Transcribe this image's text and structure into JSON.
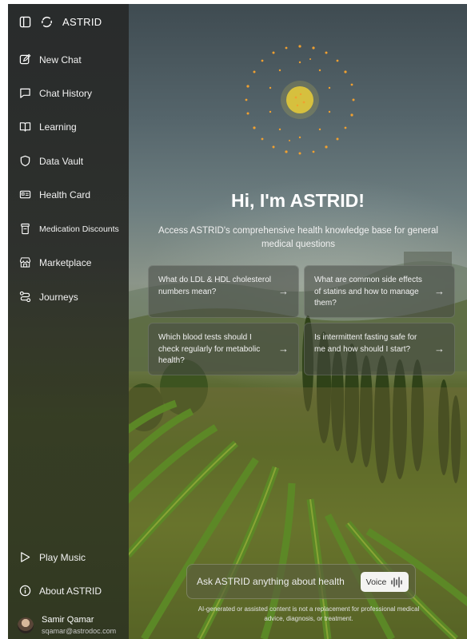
{
  "app": {
    "brand": "ASTRID"
  },
  "sidebar": {
    "items": [
      {
        "label": "New Chat",
        "icon": "edit-icon"
      },
      {
        "label": "Chat History",
        "icon": "chat-bubble-icon"
      },
      {
        "label": "Learning",
        "icon": "book-icon"
      },
      {
        "label": "Data Vault",
        "icon": "shield-icon"
      },
      {
        "label": "Health Card",
        "icon": "id-card-icon"
      },
      {
        "label": "Medication Discounts",
        "icon": "pill-bottle-icon"
      },
      {
        "label": "Marketplace",
        "icon": "store-icon"
      },
      {
        "label": "Journeys",
        "icon": "route-icon"
      }
    ],
    "bottom": [
      {
        "label": "Play Music",
        "icon": "play-icon"
      },
      {
        "label": "About ASTRID",
        "icon": "info-icon"
      }
    ],
    "user": {
      "name": "Samir Qamar",
      "email": "sqamar@astrodoc.com"
    }
  },
  "hero": {
    "title": "Hi, I'm ASTRID!",
    "subtitle": "Access ASTRID's comprehensive health knowledge base for general medical questions"
  },
  "suggestions": [
    {
      "text": "What do LDL & HDL cholesterol numbers mean?"
    },
    {
      "text": "What are common side effects of statins and how to manage them?"
    },
    {
      "text": "Which blood tests should I check regularly for metabolic health?"
    },
    {
      "text": "Is intermittent fasting safe for me and how should I start?"
    }
  ],
  "ask": {
    "placeholder": "Ask ASTRID anything about health",
    "voice_label": "Voice"
  },
  "disclaimer": "AI-generated or assisted content is not a replacement for professional medical advice, diagnosis, or treatment."
}
